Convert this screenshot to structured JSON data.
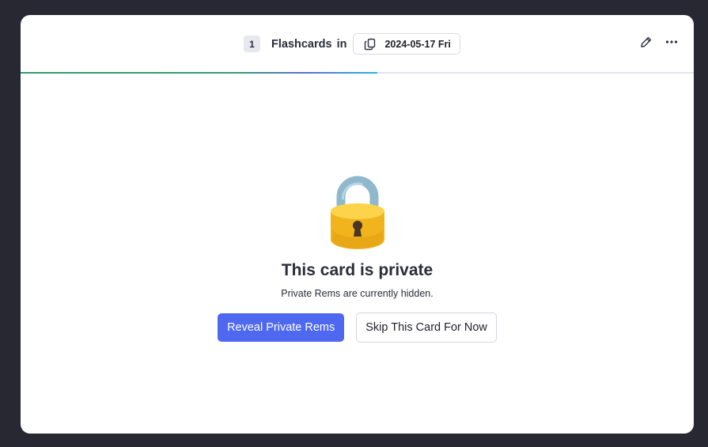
{
  "header": {
    "count": "1",
    "deck_name": "Flashcards",
    "in_word": "in",
    "document_label": "2024-05-17 Fri",
    "document_icon": "copy-icon",
    "edit_icon": "pencil-icon",
    "more_icon": "more-horizontal-icon"
  },
  "progress": {
    "fraction": 0.53
  },
  "private_notice": {
    "icon": "lock-icon",
    "title": "This card is private",
    "subtitle": "Private Rems are currently hidden."
  },
  "actions": {
    "reveal_label": "Reveal Private Rems",
    "skip_label": "Skip This Card For Now"
  },
  "colors": {
    "background": "#282833",
    "card": "#ffffff",
    "primary": "#4e69f0",
    "progress_green": "#2f9e6b",
    "progress_blue": "#2fb3e0",
    "text": "#2b2d3a"
  }
}
